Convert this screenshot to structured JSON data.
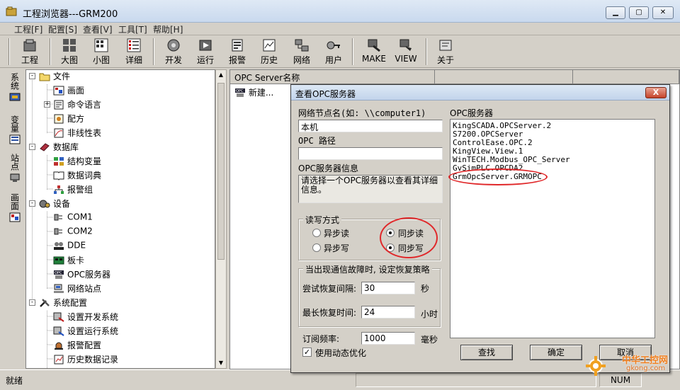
{
  "window": {
    "title": "工程浏览器---GRM200",
    "min": "▁",
    "max": "▢",
    "close": "✕"
  },
  "menu": [
    "工程[F]",
    "配置[S]",
    "查看[V]",
    "工具[T]",
    "帮助[H]"
  ],
  "toolbar": [
    "工程",
    "大图",
    "小图",
    "详细",
    "开发",
    "运行",
    "报警",
    "历史",
    "网络",
    "用户",
    "MAKE",
    "VIEW",
    "关于"
  ],
  "sidetabs": [
    "系统",
    "变量",
    "站点",
    "画面"
  ],
  "tree": {
    "items": [
      "文件",
      "画面",
      "命令语言",
      "配方",
      "非线性表",
      "数据库",
      "结构变量",
      "数据词典",
      "报警组",
      "设备",
      "COM1",
      "COM2",
      "DDE",
      "板卡",
      "OPC服务器",
      "网络站点",
      "系统配置",
      "设置开发系统",
      "设置运行系统",
      "报警配置",
      "历史数据记录"
    ],
    "expanders": [
      "-",
      "+",
      "-",
      "-",
      "-"
    ]
  },
  "panel": {
    "column": "OPC Server名称",
    "new_item": "新建..."
  },
  "status": {
    "text": "就绪",
    "num": "NUM"
  },
  "dialog": {
    "title": "查看OPC服务器",
    "close": "X",
    "node_label": "网络节点名(如: \\\\computer1)",
    "node_value": "本机",
    "path_label": "OPC 路径",
    "path_value": "",
    "info_label": "OPC服务器信息",
    "info_text": "请选择一个OPC服务器以查看其详细信息。",
    "rw_label": "读写方式",
    "rw": {
      "async_read": "异步读",
      "sync_read": "同步读",
      "async_write": "异步写",
      "sync_write": "同步写"
    },
    "recover_label": "当出现通信故障时, 设定恢复策略",
    "retry_label": "尝试恢复间隔:",
    "retry_value": "30",
    "retry_unit": "秒",
    "max_label": "最长恢复时间:",
    "max_value": "24",
    "max_unit": "小时",
    "freq_label": "订阅频率:",
    "freq_value": "1000",
    "freq_unit": "毫秒",
    "dynamic_label": "使用动态优化",
    "list_label": "OPC服务器",
    "servers": [
      "KingSCADA.OPCServer.2",
      "S7200.OPCServer",
      "ControlEase.OPC.2",
      "KingView.View.1",
      "WinTECH.Modbus_OPC_Server",
      "GvSimPLC.OPCDA2",
      "GrmOpcServer.GRMOPC"
    ],
    "btn_find": "查找",
    "btn_ok": "确定",
    "btn_cancel": "取消"
  },
  "watermark": {
    "name": "中华工控网",
    "url": "gkong.com"
  }
}
